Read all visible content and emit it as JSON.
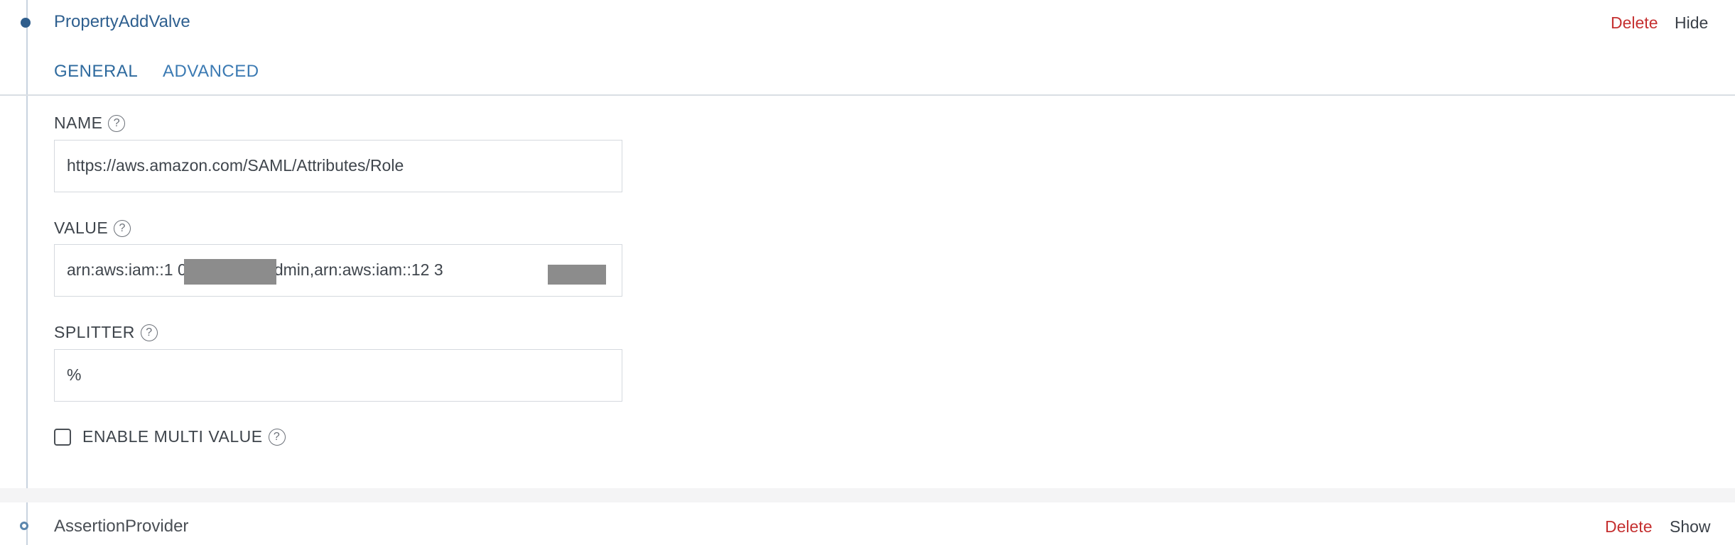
{
  "valve": {
    "title": "PropertyAddValve",
    "delete_label": "Delete",
    "hide_label": "Hide"
  },
  "tabs": [
    {
      "label": "GENERAL",
      "active": true
    },
    {
      "label": "ADVANCED",
      "active": false
    }
  ],
  "fields": {
    "name": {
      "label": "NAME",
      "value": "https://aws.amazon.com/SAML/Attributes/Role"
    },
    "value": {
      "label": "VALUE",
      "value": "arn:aws:iam::1                0:role/AWS-admin,arn:aws:iam::12          3"
    },
    "splitter": {
      "label": "SPLITTER",
      "value": "%"
    }
  },
  "multi_value": {
    "label": "ENABLE MULTI VALUE",
    "checked": false
  },
  "help_glyph": "?",
  "next_item": {
    "title": "AssertionProvider",
    "delete_label": "Delete",
    "show_label": "Show"
  },
  "colors": {
    "accent": "#2e6a9e",
    "delete": "#c53030"
  }
}
